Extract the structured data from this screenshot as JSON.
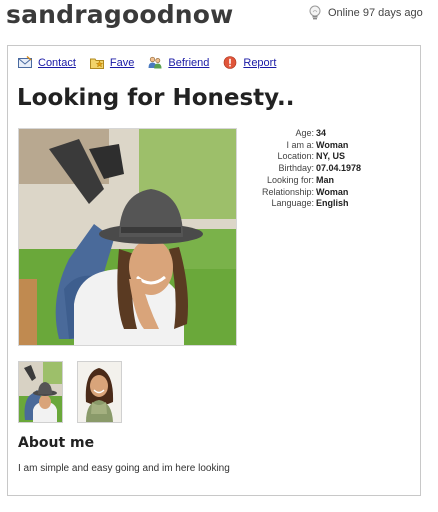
{
  "profile": {
    "username": "sandragoodnow",
    "status": "Online 97 days ago"
  },
  "actions": [
    {
      "label": "Contact",
      "icon": "envelope-icon"
    },
    {
      "label": "Fave",
      "icon": "star-folder-icon"
    },
    {
      "label": "Befriend",
      "icon": "people-icon"
    },
    {
      "label": "Report",
      "icon": "warning-icon"
    }
  ],
  "headline": "Looking for Honesty..",
  "details": [
    {
      "label": "Age:",
      "value": "34"
    },
    {
      "label": "I am a:",
      "value": "Woman"
    },
    {
      "label": "Location:",
      "value": "NY, US"
    },
    {
      "label": "Birthday:",
      "value": "07.04.1978"
    },
    {
      "label": "Looking for:",
      "value": "Man"
    },
    {
      "label": "Relationship:",
      "value": "Woman"
    },
    {
      "label": "Language:",
      "value": "English"
    }
  ],
  "about": {
    "heading": "About me",
    "text": "I am simple and easy going and im here looking"
  },
  "colors": {
    "link": "#1a1aa6",
    "border": "#c8c8c8",
    "grass": "#6aa83a"
  }
}
